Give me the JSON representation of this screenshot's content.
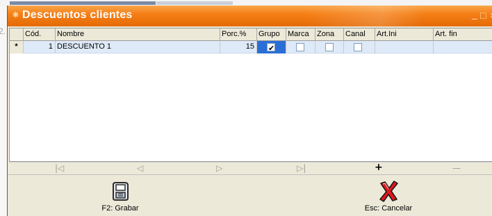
{
  "window": {
    "title": "Descuentos clientes",
    "buttons": {
      "minimize": "_",
      "maximize": "□",
      "close": "×"
    }
  },
  "background": {
    "fragment": "2."
  },
  "grid": {
    "columns": [
      "Cód.",
      "Nombre",
      "Porc.%",
      "Grupo",
      "Marca",
      "Zona",
      "Canal",
      "Art.Ini",
      "Art. fin"
    ],
    "rows": [
      {
        "indicator": "*",
        "codigo": "1",
        "nombre": "DESCUENTO 1",
        "porcentaje": "15",
        "grupo": true,
        "marca": false,
        "zona": false,
        "canal": false,
        "art_ini": "",
        "art_fin": ""
      }
    ]
  },
  "navigator": {
    "first": "|◁",
    "prior": "◁",
    "next": "▷",
    "last": "▷|",
    "insert": "+",
    "delete": "—"
  },
  "footer": {
    "save_label": "F2: Grabar",
    "cancel_label": "Esc: Cancelar"
  }
}
